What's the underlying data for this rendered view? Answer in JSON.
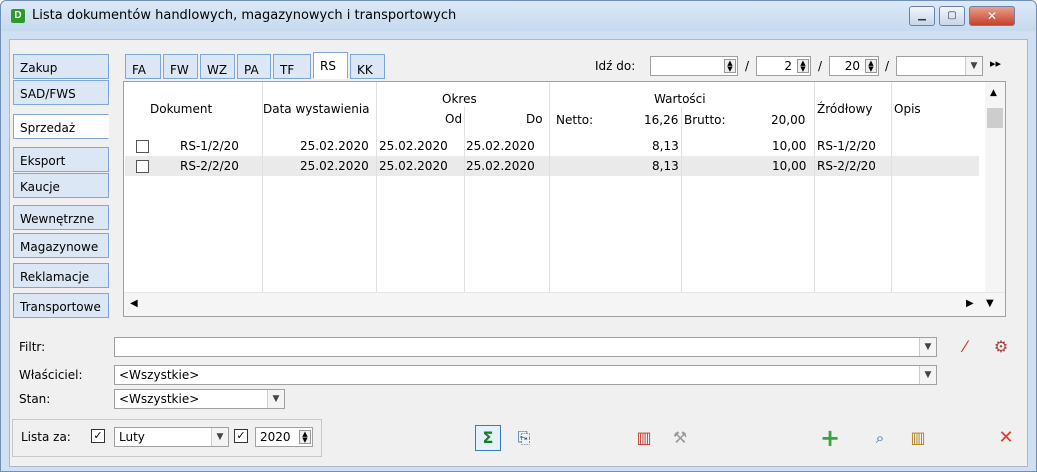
{
  "window": {
    "title": "Lista dokumentów handlowych, magazynowych i transportowych",
    "app_icon": "D",
    "minimize": "▁",
    "maximize": "▢",
    "close": "✕"
  },
  "side_tabs": [
    "Zakup",
    "SAD/FWS",
    "Sprzedaż",
    "Eksport",
    "Kaucje",
    "Wewnętrzne",
    "Magazynowe",
    "Reklamacje",
    "Transportowe"
  ],
  "active_side_tab": "Sprzedaż",
  "doc_tabs": [
    "FA",
    "FW",
    "WZ",
    "PA",
    "TF",
    "RS",
    "KK"
  ],
  "active_doc_tab": "RS",
  "goto": {
    "label": "Idź do:",
    "field1": "",
    "sep1": "/",
    "field2": "2",
    "sep2": "/",
    "field3": "20",
    "sep3": "/",
    "combo": "",
    "last_icon": "▸▸"
  },
  "grid": {
    "headers": {
      "dokument": "Dokument",
      "data": "Data wystawienia",
      "okres": "Okres",
      "od": "Od",
      "do": "Do",
      "wartosci": "Wartości",
      "netto_label": "Netto:",
      "netto_total": "16,26",
      "brutto_label": "Brutto:",
      "brutto_total": "20,00",
      "zrodlowy": "Źródłowy",
      "opis": "Opis"
    },
    "rows": [
      {
        "dokument": "RS-1/2/20",
        "data": "25.02.2020",
        "od": "25.02.2020",
        "do": "25.02.2020",
        "netto": "8,13",
        "brutto": "10,00",
        "zrodlowy": "RS-1/2/20",
        "opis": ""
      },
      {
        "dokument": "RS-2/2/20",
        "data": "25.02.2020",
        "od": "25.02.2020",
        "do": "25.02.2020",
        "netto": "8,13",
        "brutto": "10,00",
        "zrodlowy": "RS-2/2/20",
        "opis": ""
      }
    ]
  },
  "filters": {
    "filtr_label": "Filtr:",
    "filtr_value": "",
    "wlasciciel_label": "Właściciel:",
    "wlasciciel_value": "<Wszystkie>",
    "stan_label": "Stan:",
    "stan_value": "<Wszystkie>"
  },
  "lista_za": {
    "label": "Lista za:",
    "month_checked": true,
    "month": "Luty",
    "year_checked": true,
    "year": "2020"
  },
  "colors": {
    "accent_green": "#3aa53a",
    "close_red": "#d83b2a",
    "tab_blue": "#7fa7d9"
  },
  "icons": {
    "sigma": "Σ",
    "check_mark": "✓",
    "delete_x": "✕",
    "add_plus": "+",
    "search": "🔍",
    "trash": "🗑"
  }
}
